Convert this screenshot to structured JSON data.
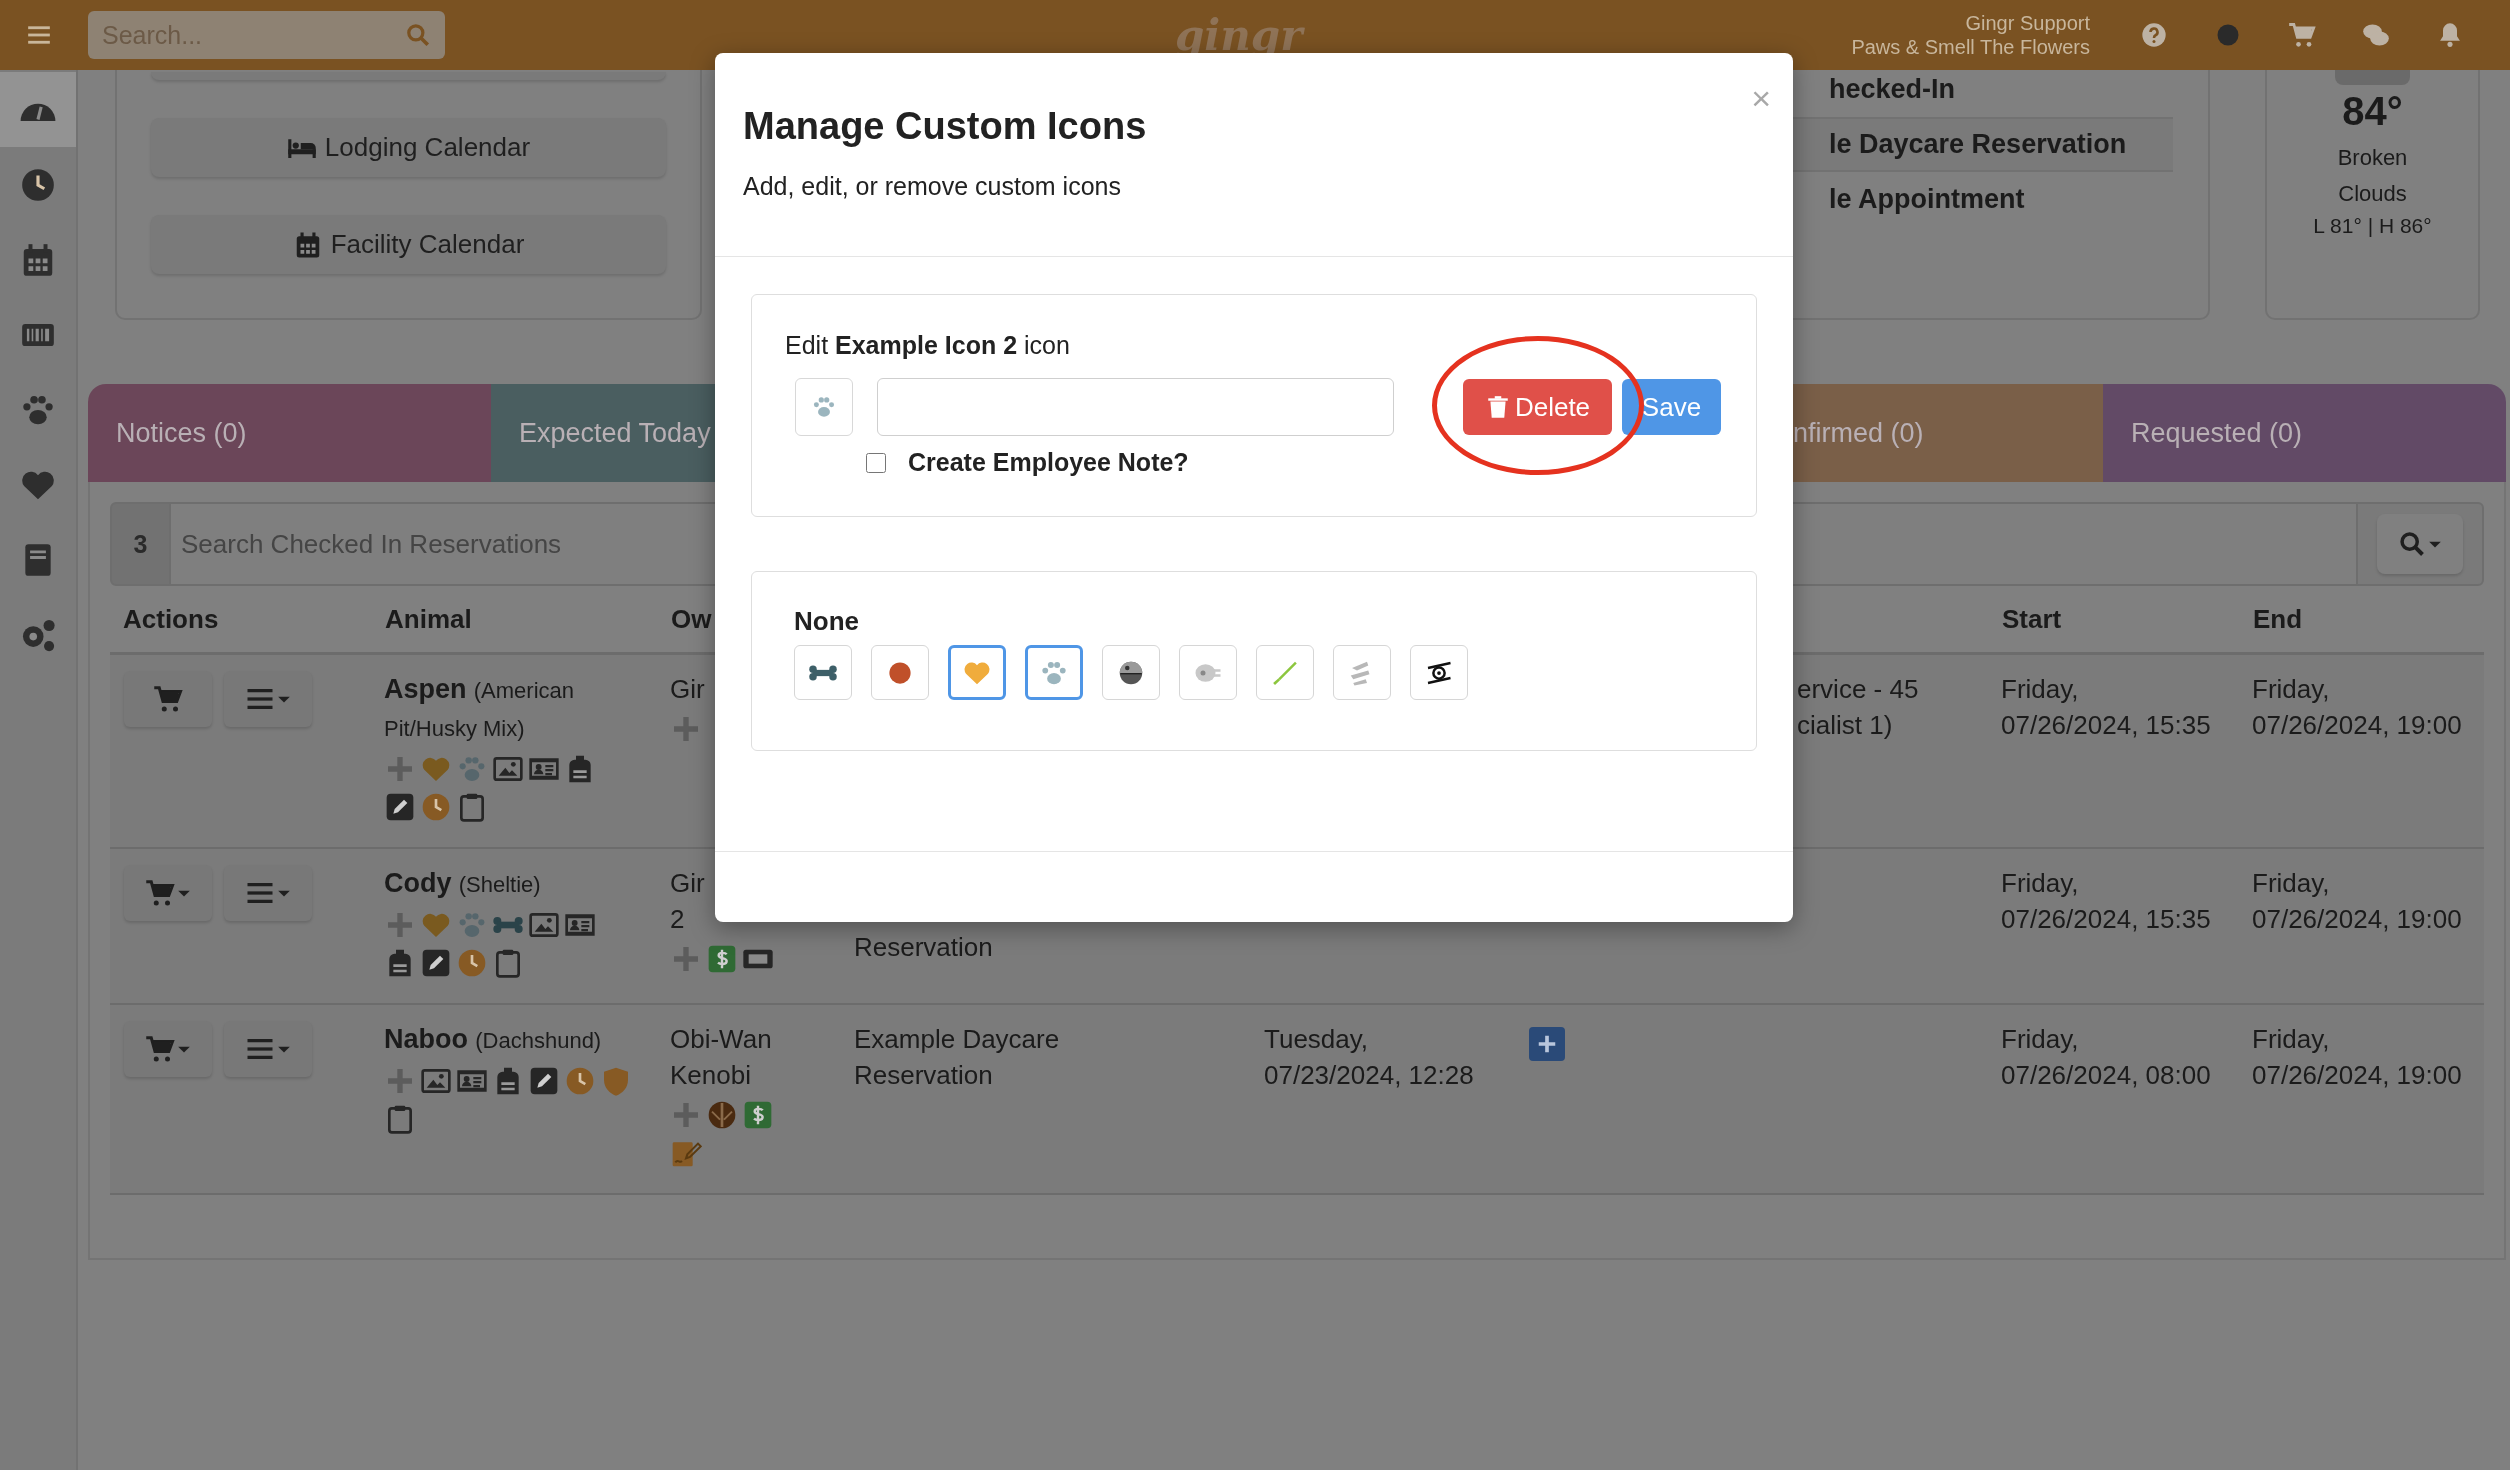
{
  "top_bar": {
    "search": {
      "placeholder": "Search..."
    },
    "logo": "gingr",
    "user": {
      "name": "Gingr Support",
      "location": "Paws & Smell The Flowers"
    },
    "icons": [
      {
        "kind": "question"
      },
      {
        "kind": "circle"
      },
      {
        "kind": "cart"
      },
      {
        "kind": "chat"
      },
      {
        "kind": "bell"
      }
    ]
  },
  "sidebar": {
    "items": [
      {
        "kind": "gauge",
        "selected": true
      },
      {
        "kind": "clock",
        "selected": false
      },
      {
        "kind": "calendar",
        "selected": false
      },
      {
        "kind": "barcode",
        "selected": false
      },
      {
        "kind": "paw",
        "selected": false
      },
      {
        "kind": "heart",
        "selected": false
      },
      {
        "kind": "book",
        "selected": false
      },
      {
        "kind": "gears",
        "selected": false
      }
    ]
  },
  "quick_links": [
    {
      "kind": "bed",
      "label": "Lodging Calendar"
    },
    {
      "kind": "calendar",
      "label": "Facility Calendar"
    }
  ],
  "summary": {
    "rows": [
      "hecked-In",
      "le Daycare Reservation",
      "le Appointment"
    ]
  },
  "weather": {
    "temperature": "84°",
    "condition": "Broken Clouds",
    "range": "L 81° | H 86°"
  },
  "tabs": [
    {
      "label": "Notices (0)",
      "color": "#6b4659"
    },
    {
      "label": "Expected Today",
      "color": "#4a5e60"
    },
    {
      "label": "nfirmed (0)",
      "color": "#7a5f48"
    },
    {
      "label": "Requested (0)",
      "color": "#624a66"
    }
  ],
  "reservations": {
    "count": "3",
    "search": {
      "placeholder": "Search Checked In Reservations"
    },
    "columns": [
      {
        "label": "Actions"
      },
      {
        "label": "Animal"
      },
      {
        "label": "Ow"
      },
      {
        "label": "Start"
      },
      {
        "label": "End"
      }
    ],
    "rows": [
      {
        "actions": [
          {
            "kind": "cart",
            "dropdown": false
          },
          {
            "kind": "menu",
            "dropdown": true
          }
        ],
        "animal": {
          "name": "Aspen",
          "breed": "(American Pit/Husky Mix)",
          "badge_lines": [
            [
              {
                "kind": "plus"
              },
              {
                "kind": "heart"
              },
              {
                "kind": "paw"
              },
              {
                "kind": "image"
              },
              {
                "kind": "id-card"
              },
              {
                "kind": "backpack"
              }
            ],
            [
              {
                "kind": "pencil"
              },
              {
                "kind": "clock"
              },
              {
                "kind": "clipboard"
              }
            ]
          ]
        },
        "owner": {
          "name": "Gir",
          "badge_lines": [
            [
              {
                "kind": "plus"
              }
            ]
          ]
        },
        "service_tail": "ervice - 45\ncialist 1)",
        "add_button": false,
        "start": "Friday,\n07/26/2024, 15:35",
        "end": "Friday,\n07/26/2024, 19:00"
      },
      {
        "actions": [
          {
            "kind": "cart",
            "dropdown": true
          },
          {
            "kind": "menu",
            "dropdown": true
          }
        ],
        "animal": {
          "name": "Cody",
          "breed": "(Sheltie)",
          "badge_lines": [
            [
              {
                "kind": "plus"
              },
              {
                "kind": "heart"
              },
              {
                "kind": "paw"
              },
              {
                "kind": "bone"
              },
              {
                "kind": "image"
              },
              {
                "kind": "id-card"
              }
            ],
            [
              {
                "kind": "backpack"
              },
              {
                "kind": "pencil"
              },
              {
                "kind": "clock"
              },
              {
                "kind": "clipboard"
              }
            ]
          ]
        },
        "owner": {
          "name": "Gir\n2",
          "badge_lines": [
            [
              {
                "kind": "plus"
              },
              {
                "kind": "banknote"
              },
              {
                "kind": "ticket"
              }
            ]
          ]
        },
        "service": "Reservation",
        "add_button": false,
        "start": "Friday,\n07/26/2024, 15:35",
        "end": "Friday,\n07/26/2024, 19:00"
      },
      {
        "actions": [
          {
            "kind": "cart",
            "dropdown": true
          },
          {
            "kind": "menu",
            "dropdown": true
          }
        ],
        "animal": {
          "name": "Naboo",
          "breed": "(Dachshund)",
          "badge_lines": [
            [
              {
                "kind": "plus"
              },
              {
                "kind": "image"
              },
              {
                "kind": "id-card"
              },
              {
                "kind": "backpack"
              },
              {
                "kind": "pencil"
              },
              {
                "kind": "clock"
              },
              {
                "kind": "shield"
              }
            ],
            [
              {
                "kind": "clipboard"
              }
            ]
          ]
        },
        "owner": {
          "name": "Obi-Wan Kenobi",
          "badge_lines": [
            [
              {
                "kind": "plus"
              },
              {
                "kind": "emblem"
              },
              {
                "kind": "banknote"
              }
            ],
            [
              {
                "kind": "signature"
              }
            ]
          ]
        },
        "service": "Example Daycare\nReservation",
        "checked_in": "Tuesday,\n07/23/2024, 12:28",
        "add_button": true,
        "start": "Friday,\n07/26/2024, 08:00",
        "end": "Friday,\n07/26/2024, 19:00"
      }
    ]
  },
  "modal": {
    "title": "Manage Custom Icons",
    "subtitle": "Add, edit, or remove custom icons",
    "close": "×",
    "editor": {
      "heading": "Edit **Example Icon 2** icon",
      "preview": {
        "kind": "paw"
      },
      "employee_note": {
        "label": "Create Employee Note?",
        "checked": false
      },
      "delete_label": "Delete",
      "save_label": "Save",
      "highlighted": true
    },
    "icon_group": {
      "title": "None",
      "icons": [
        {
          "kind": "bone",
          "selected": false
        },
        {
          "kind": "dot",
          "selected": false
        },
        {
          "kind": "heart",
          "selected": true
        },
        {
          "kind": "paw",
          "selected": true
        },
        {
          "kind": "sphere",
          "selected": false
        },
        {
          "kind": "spaceship",
          "selected": false
        },
        {
          "kind": "stick",
          "selected": false
        },
        {
          "kind": "ship",
          "selected": false
        },
        {
          "kind": "fighter",
          "selected": false
        }
      ]
    }
  }
}
